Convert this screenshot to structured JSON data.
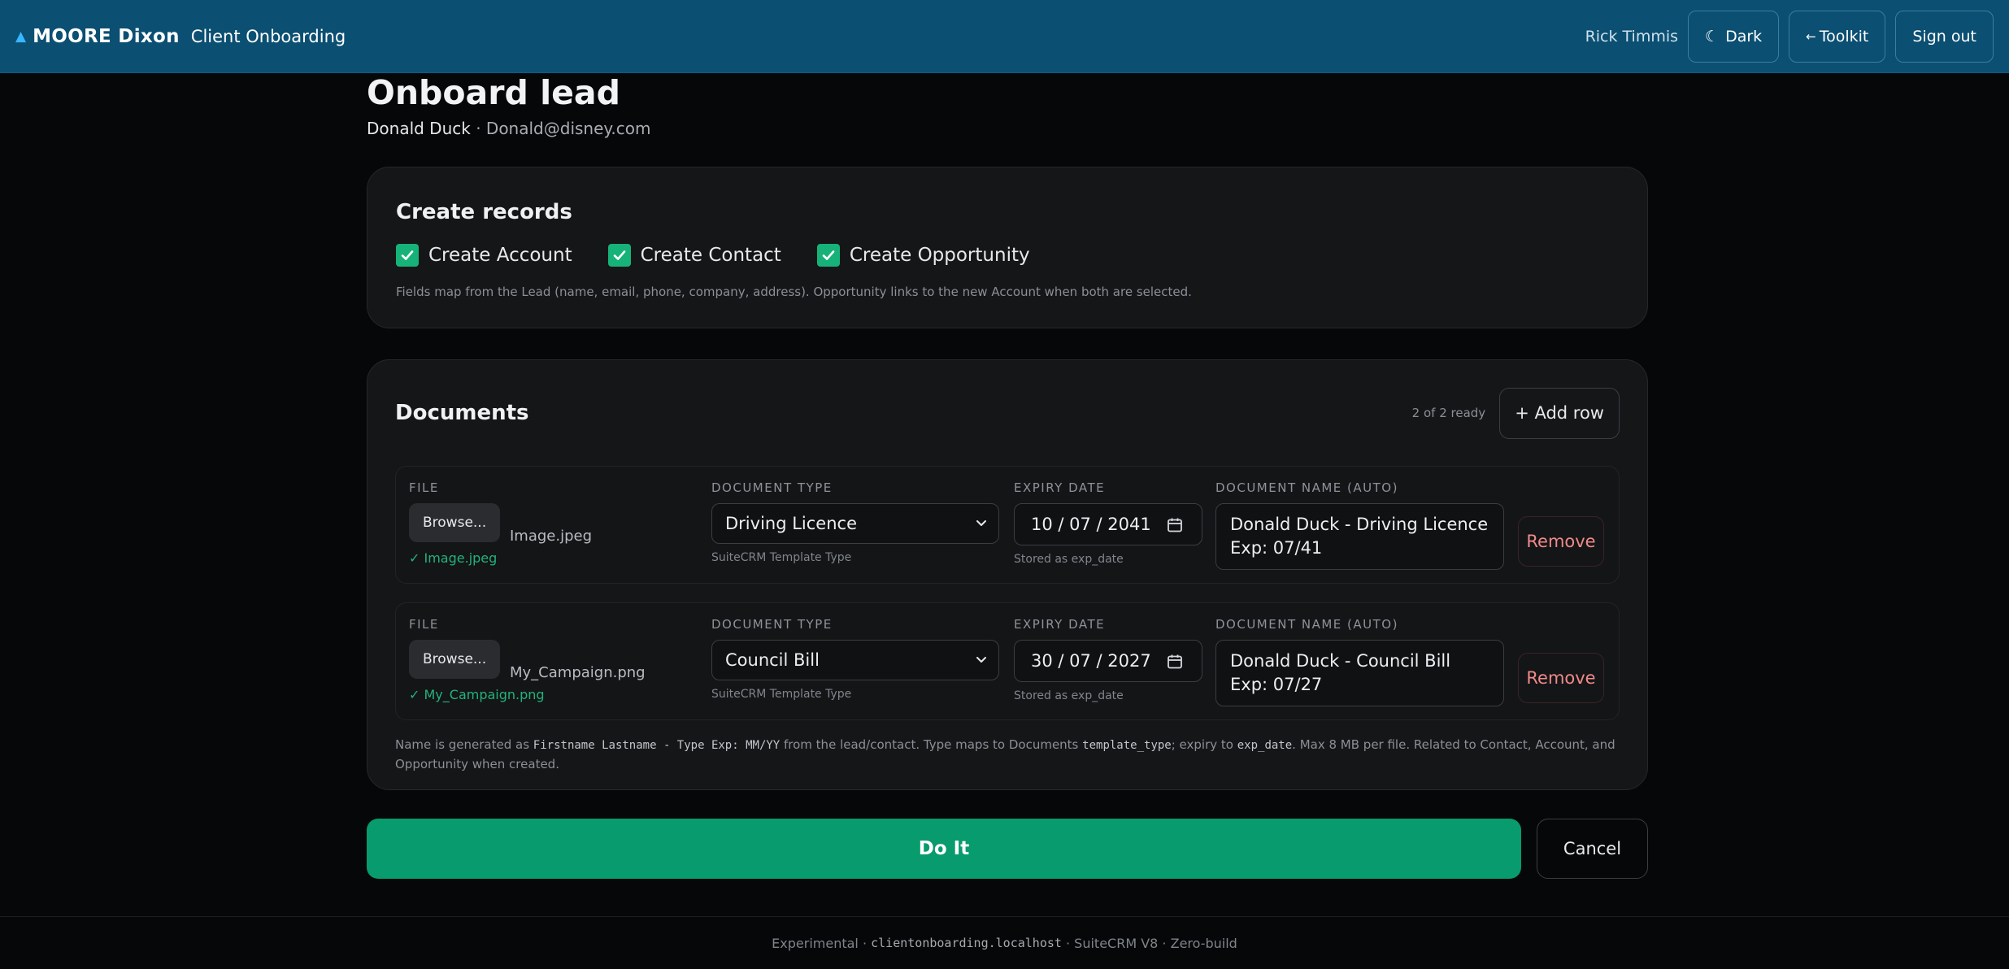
{
  "header": {
    "brand_mark": "▲",
    "brand": "MOORE Dixon",
    "app": "Client Onboarding",
    "user": "Rick Timmis",
    "theme_label": "Dark",
    "toolkit_label": "Toolkit",
    "signout_label": "Sign out"
  },
  "page": {
    "title": "Onboard lead",
    "lead_name": "Donald Duck",
    "separator": " · ",
    "lead_email": "Donald@disney.com"
  },
  "records": {
    "title": "Create records",
    "options": [
      {
        "label": "Create Account",
        "checked": true
      },
      {
        "label": "Create Contact",
        "checked": true
      },
      {
        "label": "Create Opportunity",
        "checked": true
      }
    ],
    "hint": "Fields map from the Lead (name, email, phone, company, address). Opportunity links to the new Account when both are selected."
  },
  "documents": {
    "title": "Documents",
    "count": "2 of 2 ready",
    "add_row_label": "+ Add row",
    "col_file": "FILE",
    "col_type": "DOCUMENT TYPE",
    "col_expiry": "EXPIRY DATE",
    "col_name": "DOCUMENT NAME (AUTO)",
    "browse_label": "Browse...",
    "type_sub": "SuiteCRM Template Type",
    "expiry_sub": "Stored as exp_date",
    "remove_label": "Remove",
    "rows": [
      {
        "file": "Image.jpeg",
        "file_ok": "✓ Image.jpeg",
        "type": "Driving Licence",
        "expiry": "10 / 07 / 2041",
        "name": "Donald Duck - Driving Licence Exp: 07/41"
      },
      {
        "file": "My_Campaign.png",
        "file_ok": "✓ My_Campaign.png",
        "type": "Council Bill",
        "expiry": "30 / 07 / 2027",
        "name": "Donald Duck - Council Bill Exp: 07/27"
      }
    ],
    "note": {
      "p1": "Name is generated as ",
      "c1": "Firstname Lastname - Type Exp: MM/YY",
      "p2": " from the lead/contact. Type maps to Documents ",
      "c2": "template_type",
      "p3": "; expiry to ",
      "c3": "exp_date",
      "p4": ". Max 8 MB per file. Related to Contact, Account, and Opportunity when created."
    }
  },
  "actions": {
    "do_it": "Do It",
    "cancel": "Cancel"
  },
  "footer": {
    "p1": "Experimental · ",
    "host": "clientonboarding.localhost",
    "p2": " · SuiteCRM V8 · Zero-build"
  },
  "colors": {
    "header_bg": "#0b4f72",
    "accent_green": "#089b6d",
    "remove_red": "#f08a8a"
  }
}
